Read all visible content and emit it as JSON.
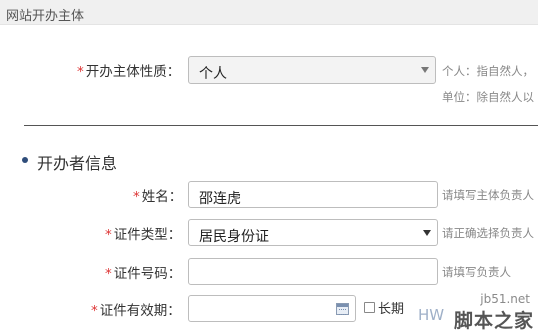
{
  "section": {
    "title": "网站开办主体"
  },
  "nature": {
    "label": "开办主体性质：",
    "value": "个人",
    "hint_line1": "个人：指自然人，",
    "hint_line2": "单位：除自然人以"
  },
  "group": {
    "title": "开办者信息"
  },
  "name_field": {
    "label": "姓名：",
    "value": "邵连虎",
    "hint": "请填写主体负责人"
  },
  "id_type": {
    "label": "证件类型：",
    "value": "居民身份证",
    "hint": "请正确选择负责人"
  },
  "id_number": {
    "label": "证件号码：",
    "value": "",
    "hint": "请填写负责人"
  },
  "id_validity": {
    "label": "证件有效期：",
    "value": "",
    "long_term_label": "长期"
  },
  "required_mark": "*",
  "watermark": {
    "url": "jb51.net",
    "prefix": "HW",
    "text": "脚本之家"
  },
  "colors": {
    "required": "#dd3333",
    "header_bg": "#f0f0f0",
    "bullet": "#2f4d7a"
  }
}
